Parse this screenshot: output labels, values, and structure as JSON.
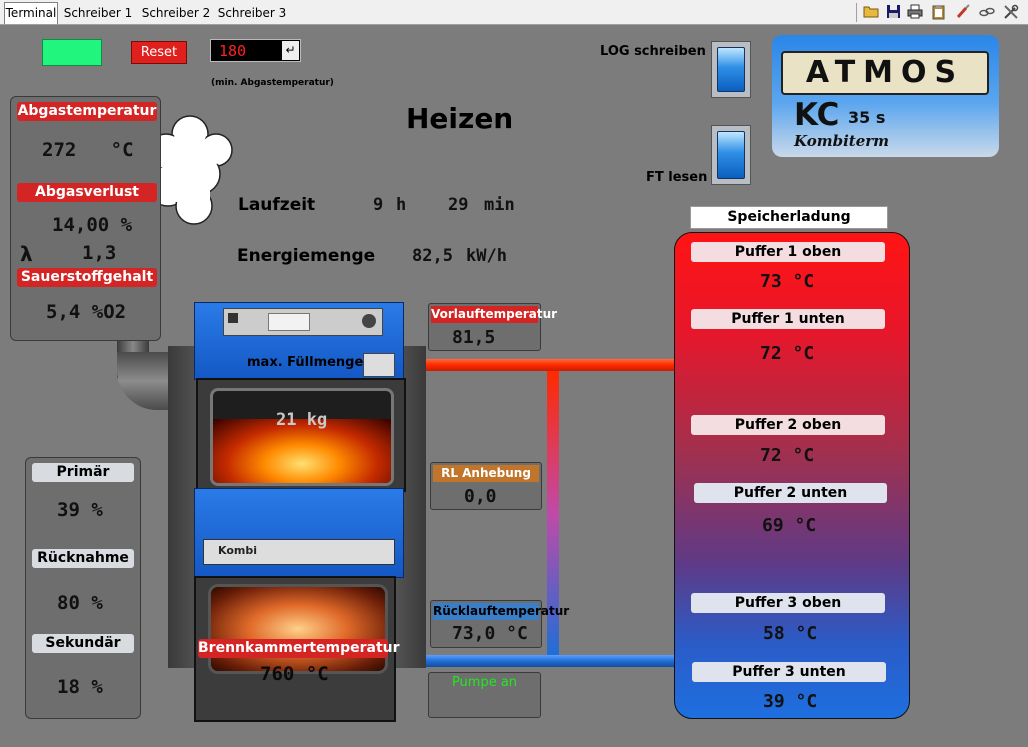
{
  "tabs": [
    "Terminal",
    "Schreiber 1",
    "Schreiber 2",
    "Schreiber 3"
  ],
  "toolbar_icons": [
    "open-folder-icon",
    "save-icon",
    "print-icon",
    "clipboard-icon",
    "brush-icon",
    "chain-icon",
    "tools-icon"
  ],
  "controls": {
    "reset_label": "Reset",
    "abgas_input_value": "180",
    "abgas_input_caption": "(min. Abgastemperatur)",
    "enter_glyph": "↵"
  },
  "state_title": "Heizen",
  "log_label": "LOG schreiben",
  "ft_label": "FT lesen",
  "brand": {
    "name": "ATMOS",
    "model": "KC",
    "model_suffix": "35 s",
    "subtitle": "Kombiterm"
  },
  "exhaust": {
    "abgastemperatur_label": "Abgastemperatur",
    "abgastemperatur_value": "272   °C",
    "abgasverlust_label": "Abgasverlust",
    "abgasverlust_value": "14,00 %",
    "lambda_symbol": "λ",
    "lambda_value": "1,3",
    "sauerstoff_label": "Sauerstoffgehalt",
    "sauerstoff_value": "5,4 %O2"
  },
  "runtime": {
    "label": "Laufzeit",
    "hours": "9",
    "h_unit": "h",
    "minutes": "29",
    "min_unit": "min"
  },
  "energy": {
    "label": "Energiemenge",
    "value": "82,5",
    "unit": "kW/h"
  },
  "air": {
    "primaer_label": "Primär",
    "primaer_value": "39 %",
    "ruecknahme_label": "Rücknahme",
    "ruecknahme_value": "80 %",
    "sekundaer_label": "Sekundär",
    "sekundaer_value": "18 %"
  },
  "boiler": {
    "fill_label": "max. Füllmenge",
    "fill_value": "21 kg",
    "chamber_label": "Brennkammertemperatur",
    "chamber_value": "760 °C",
    "panel_brand": "Kombi"
  },
  "circuit": {
    "vorlauf_label": "Vorlauftemperatur",
    "vorlauf_value": "81,5",
    "rl_label": "RL Anhebung",
    "rl_value": "0,0",
    "ruecklauf_label": "Rücklauftemperatur",
    "ruecklauf_value": "73,0 °C",
    "pumpe_label": "Pumpe an"
  },
  "storage": {
    "title": "Speicherladung",
    "items": [
      {
        "label": "Puffer 1 oben",
        "value": "73 °C"
      },
      {
        "label": "Puffer 1 unten",
        "value": "72 °C"
      },
      {
        "label": "Puffer 2 oben",
        "value": "72 °C"
      },
      {
        "label": "Puffer 2 unten",
        "value": "69 °C"
      },
      {
        "label": "Puffer 3 oben",
        "value": "58 °C"
      },
      {
        "label": "Puffer 3 unten",
        "value": "39 °C"
      }
    ]
  },
  "colors": {
    "status_green": "#22f57d",
    "alarm_red": "#e0201c",
    "hot_pipe": "#ff2a00",
    "cold_pipe": "#1f6ed6",
    "tank_top": "#ff1414",
    "tank_bottom": "#1e6fe0"
  }
}
